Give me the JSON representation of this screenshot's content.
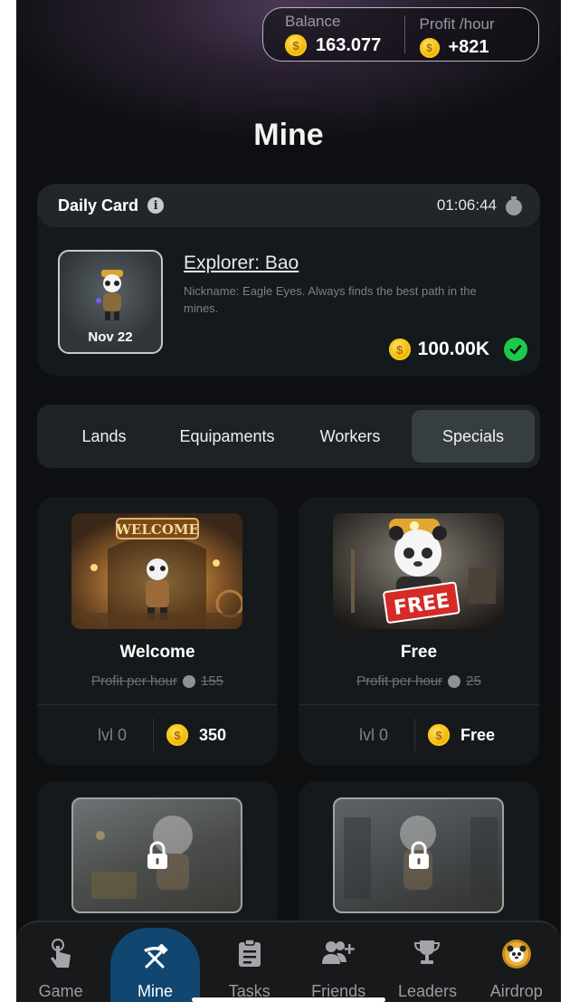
{
  "header": {
    "balance_label": "Balance",
    "balance_value": "163.077",
    "profit_label": "Profit /hour",
    "profit_value": "+821"
  },
  "page_title": "Mine",
  "daily_card": {
    "title": "Daily Card",
    "timer": "01:06:44",
    "card_date": "Nov 22",
    "card_name": "Explorer: Bao",
    "card_description": "Nickname: Eagle Eyes. Always finds the best path in the mines.",
    "reward": "100.00K",
    "claimed": true
  },
  "tabs": [
    {
      "label": "Lands",
      "active": false
    },
    {
      "label": "Equipaments",
      "active": false
    },
    {
      "label": "Workers",
      "active": false
    },
    {
      "label": "Specials",
      "active": true
    }
  ],
  "items": [
    {
      "name": "Welcome",
      "profit_label": "Profit per hour",
      "profit_value": "155",
      "level": "lvl 0",
      "price": "350",
      "image_text": "WELCOME"
    },
    {
      "name": "Free",
      "profit_label": "Profit per hour",
      "profit_value": "25",
      "level": "lvl 0",
      "price": "Free",
      "image_text": "FREE"
    }
  ],
  "locked_items": [
    {
      "locked": true
    },
    {
      "locked": true
    }
  ],
  "nav": [
    {
      "label": "Game",
      "icon": "tap-hand-icon",
      "active": false
    },
    {
      "label": "Mine",
      "icon": "pickaxe-hammer-icon",
      "active": true
    },
    {
      "label": "Tasks",
      "icon": "clipboard-icon",
      "active": false
    },
    {
      "label": "Friends",
      "icon": "add-friends-icon",
      "active": false
    },
    {
      "label": "Leaders",
      "icon": "trophy-icon",
      "active": false
    },
    {
      "label": "Airdrop",
      "icon": "panda-coin-icon",
      "active": false
    }
  ],
  "colors": {
    "accent_blue": "#10466f",
    "coin_gold": "#f2b705",
    "check_green": "#1ec84a",
    "background": "#0e0f12"
  }
}
